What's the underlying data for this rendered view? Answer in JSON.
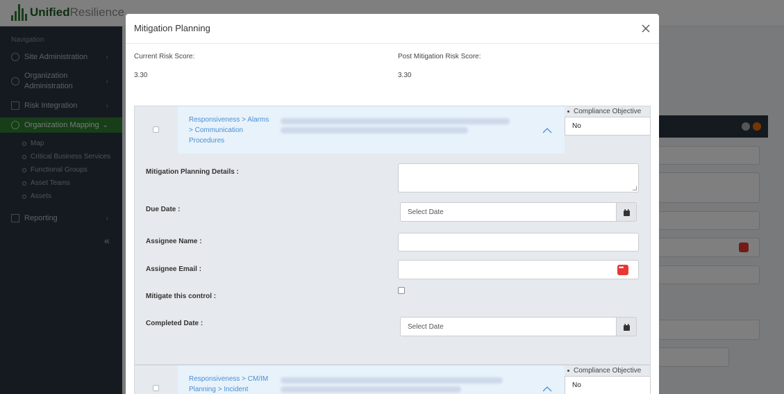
{
  "app": {
    "logo_text_bold": "Unified",
    "logo_text_light": "Resilience"
  },
  "sidebar": {
    "heading": "Navigation",
    "items": [
      {
        "label": "Site Administration"
      },
      {
        "label": "Organization Administration"
      },
      {
        "label": "Risk Integration"
      },
      {
        "label": "Organization Mapping"
      },
      {
        "label": "Reporting"
      }
    ],
    "sub_items": [
      {
        "label": "Map"
      },
      {
        "label": "Critical Business Services"
      },
      {
        "label": "Functional Groups"
      },
      {
        "label": "Asset Teams"
      },
      {
        "label": "Assets"
      }
    ],
    "collapse_label": "«"
  },
  "modal": {
    "title": "Mitigation Planning",
    "current_risk_label": "Current Risk Score:",
    "current_risk_value": "3.30",
    "post_risk_label": "Post Mitigation Risk Score:",
    "post_risk_value": "3.30",
    "controls": [
      {
        "breadcrumb": "Responsiveness > Alarms > Communication Procedures",
        "compliance_label": "Compliance Objective",
        "compliance_value": "No",
        "form": {
          "details_label": "Mitigation Planning Details :",
          "due_date_label": "Due Date :",
          "due_date_placeholder": "Select Date",
          "assignee_name_label": "Assignee Name :",
          "assignee_email_label": "Assignee Email :",
          "mitigate_label": "Mitigate this control :",
          "completed_date_label": "Completed Date :",
          "completed_date_placeholder": "Select Date"
        }
      },
      {
        "breadcrumb": "Responsiveness > CM/IM Planning > Incident",
        "compliance_label": "Compliance Objective",
        "compliance_value": "No"
      }
    ]
  }
}
